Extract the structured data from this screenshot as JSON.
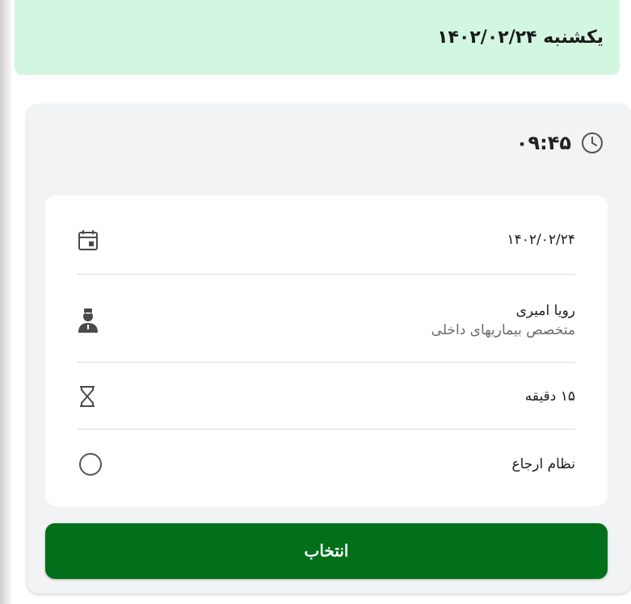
{
  "header": {
    "title": "یکشنبه ۱۴۰۲/۰۲/۲۴"
  },
  "slot": {
    "time": "۰۹:۴۵",
    "time_icon": "clock-icon"
  },
  "details": {
    "date": {
      "icon": "calendar-icon",
      "value": "۱۴۰۲/۰۲/۲۴"
    },
    "doctor": {
      "icon": "doctor-icon",
      "name": "رویا امیری",
      "specialty": "متخصص بیماریهای داخلی"
    },
    "duration": {
      "icon": "hourglass-icon",
      "value": "۱۵ دقیقه"
    },
    "referral": {
      "icon": "radio-circle-icon",
      "label": "نظام ارجاع",
      "checked": false
    }
  },
  "actions": {
    "select_label": "انتخاب"
  },
  "colors": {
    "header_bg": "#d3f6e1",
    "button_bg": "#026f1a"
  }
}
